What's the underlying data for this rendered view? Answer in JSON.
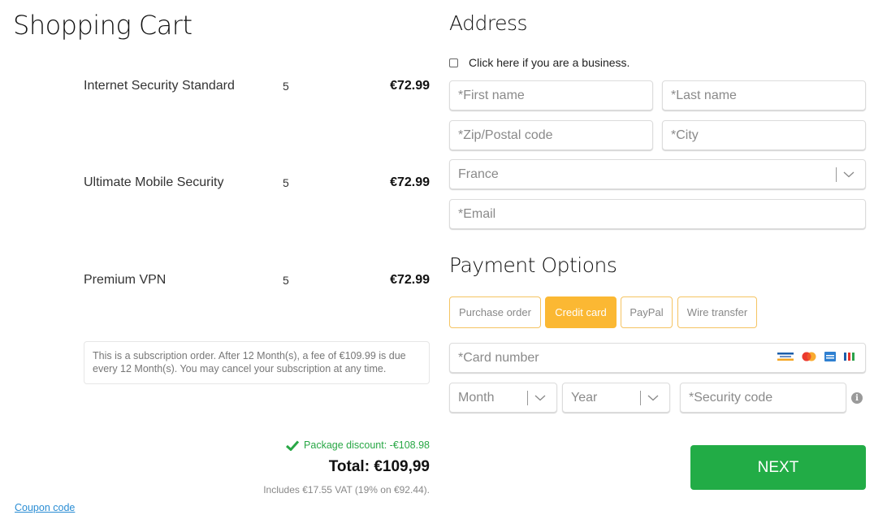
{
  "cart": {
    "title": "Shopping Cart",
    "items": [
      {
        "name": "Internet Security Standard",
        "qty": "5",
        "price": "€72.99"
      },
      {
        "name": "Ultimate Mobile Security",
        "qty": "5",
        "price": "€72.99"
      },
      {
        "name": "Premium VPN",
        "qty": "5",
        "price": "€72.99"
      }
    ],
    "subscription_note": "This is a subscription order. After 12 Month(s), a fee of €109.99 is due every 12 Month(s). You may cancel your subscription at any time.",
    "discount": "Package discount: -€108.98",
    "total": "Total: €109,99",
    "vat": "Includes €17.55 VAT (19% on €92.44).",
    "coupon_link": "Coupon code"
  },
  "address": {
    "title": "Address",
    "business_checkbox": {
      "label": "Click here if you are a business.",
      "checked": false
    },
    "first_name_placeholder": "*First name",
    "last_name_placeholder": "*Last name",
    "zip_placeholder": "*Zip/Postal code",
    "city_placeholder": "*City",
    "country_selected": "France",
    "email_placeholder": "*Email"
  },
  "payment": {
    "title": "Payment Options",
    "methods": [
      {
        "label": "Purchase order",
        "active": false
      },
      {
        "label": "Credit card",
        "active": true
      },
      {
        "label": "PayPal",
        "active": false
      },
      {
        "label": "Wire transfer",
        "active": false
      }
    ],
    "card_number_placeholder": "*Card number",
    "card_icons": [
      "generic-card-icon",
      "mastercard-icon",
      "card-icon",
      "striped-card-icon"
    ],
    "month_selected": "Month",
    "year_selected": "Year",
    "security_code_placeholder": "*Security code",
    "info_glyph": "i"
  },
  "next_button": "NEXT",
  "colors": {
    "accent": "#fbb833",
    "success": "#22ac46",
    "link": "#2a8dd4"
  }
}
